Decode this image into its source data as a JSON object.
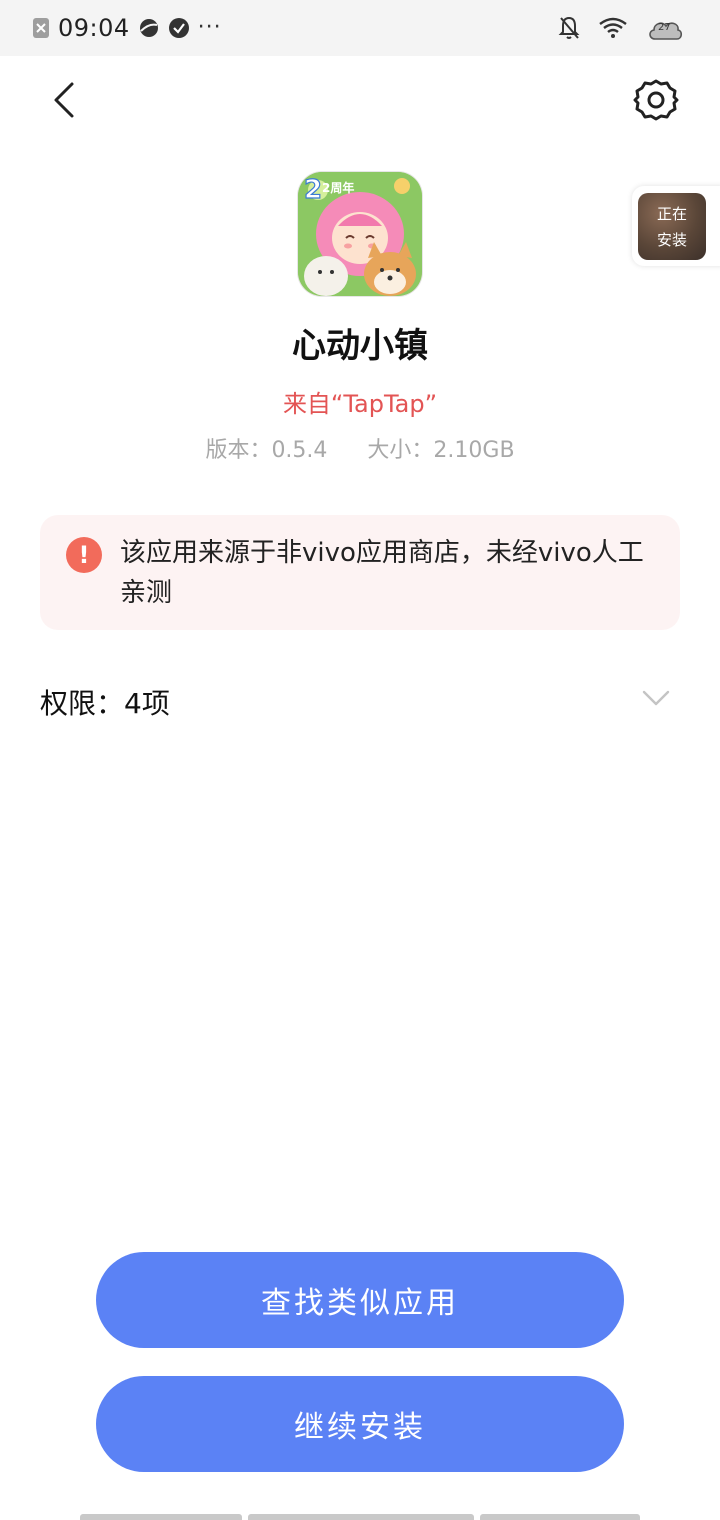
{
  "status_bar": {
    "time": "09:04",
    "dots": "···",
    "weather_badge": "27"
  },
  "nav": {
    "back_icon": "chevron-left-icon",
    "settings_icon": "gear-icon"
  },
  "floating_widget": {
    "line1": "正在",
    "line2": "安装"
  },
  "app": {
    "icon_badge": "2周年",
    "name": "心动小镇",
    "source": "来自“TapTap”",
    "version": "版本：0.5.4",
    "size": "大小：2.10GB"
  },
  "warning": {
    "icon": "exclamation-icon",
    "text": "该应用来源于非vivo应用商店，未经vivo人工亲测"
  },
  "permissions": {
    "label": "权限：4项"
  },
  "buttons": {
    "find_similar": "查找类似应用",
    "continue_install": "继续安装"
  },
  "colors": {
    "accent": "#5b82f5",
    "source_red": "#e35454",
    "warning_bg": "#fdf3f3",
    "warning_icon": "#f26b5b"
  }
}
